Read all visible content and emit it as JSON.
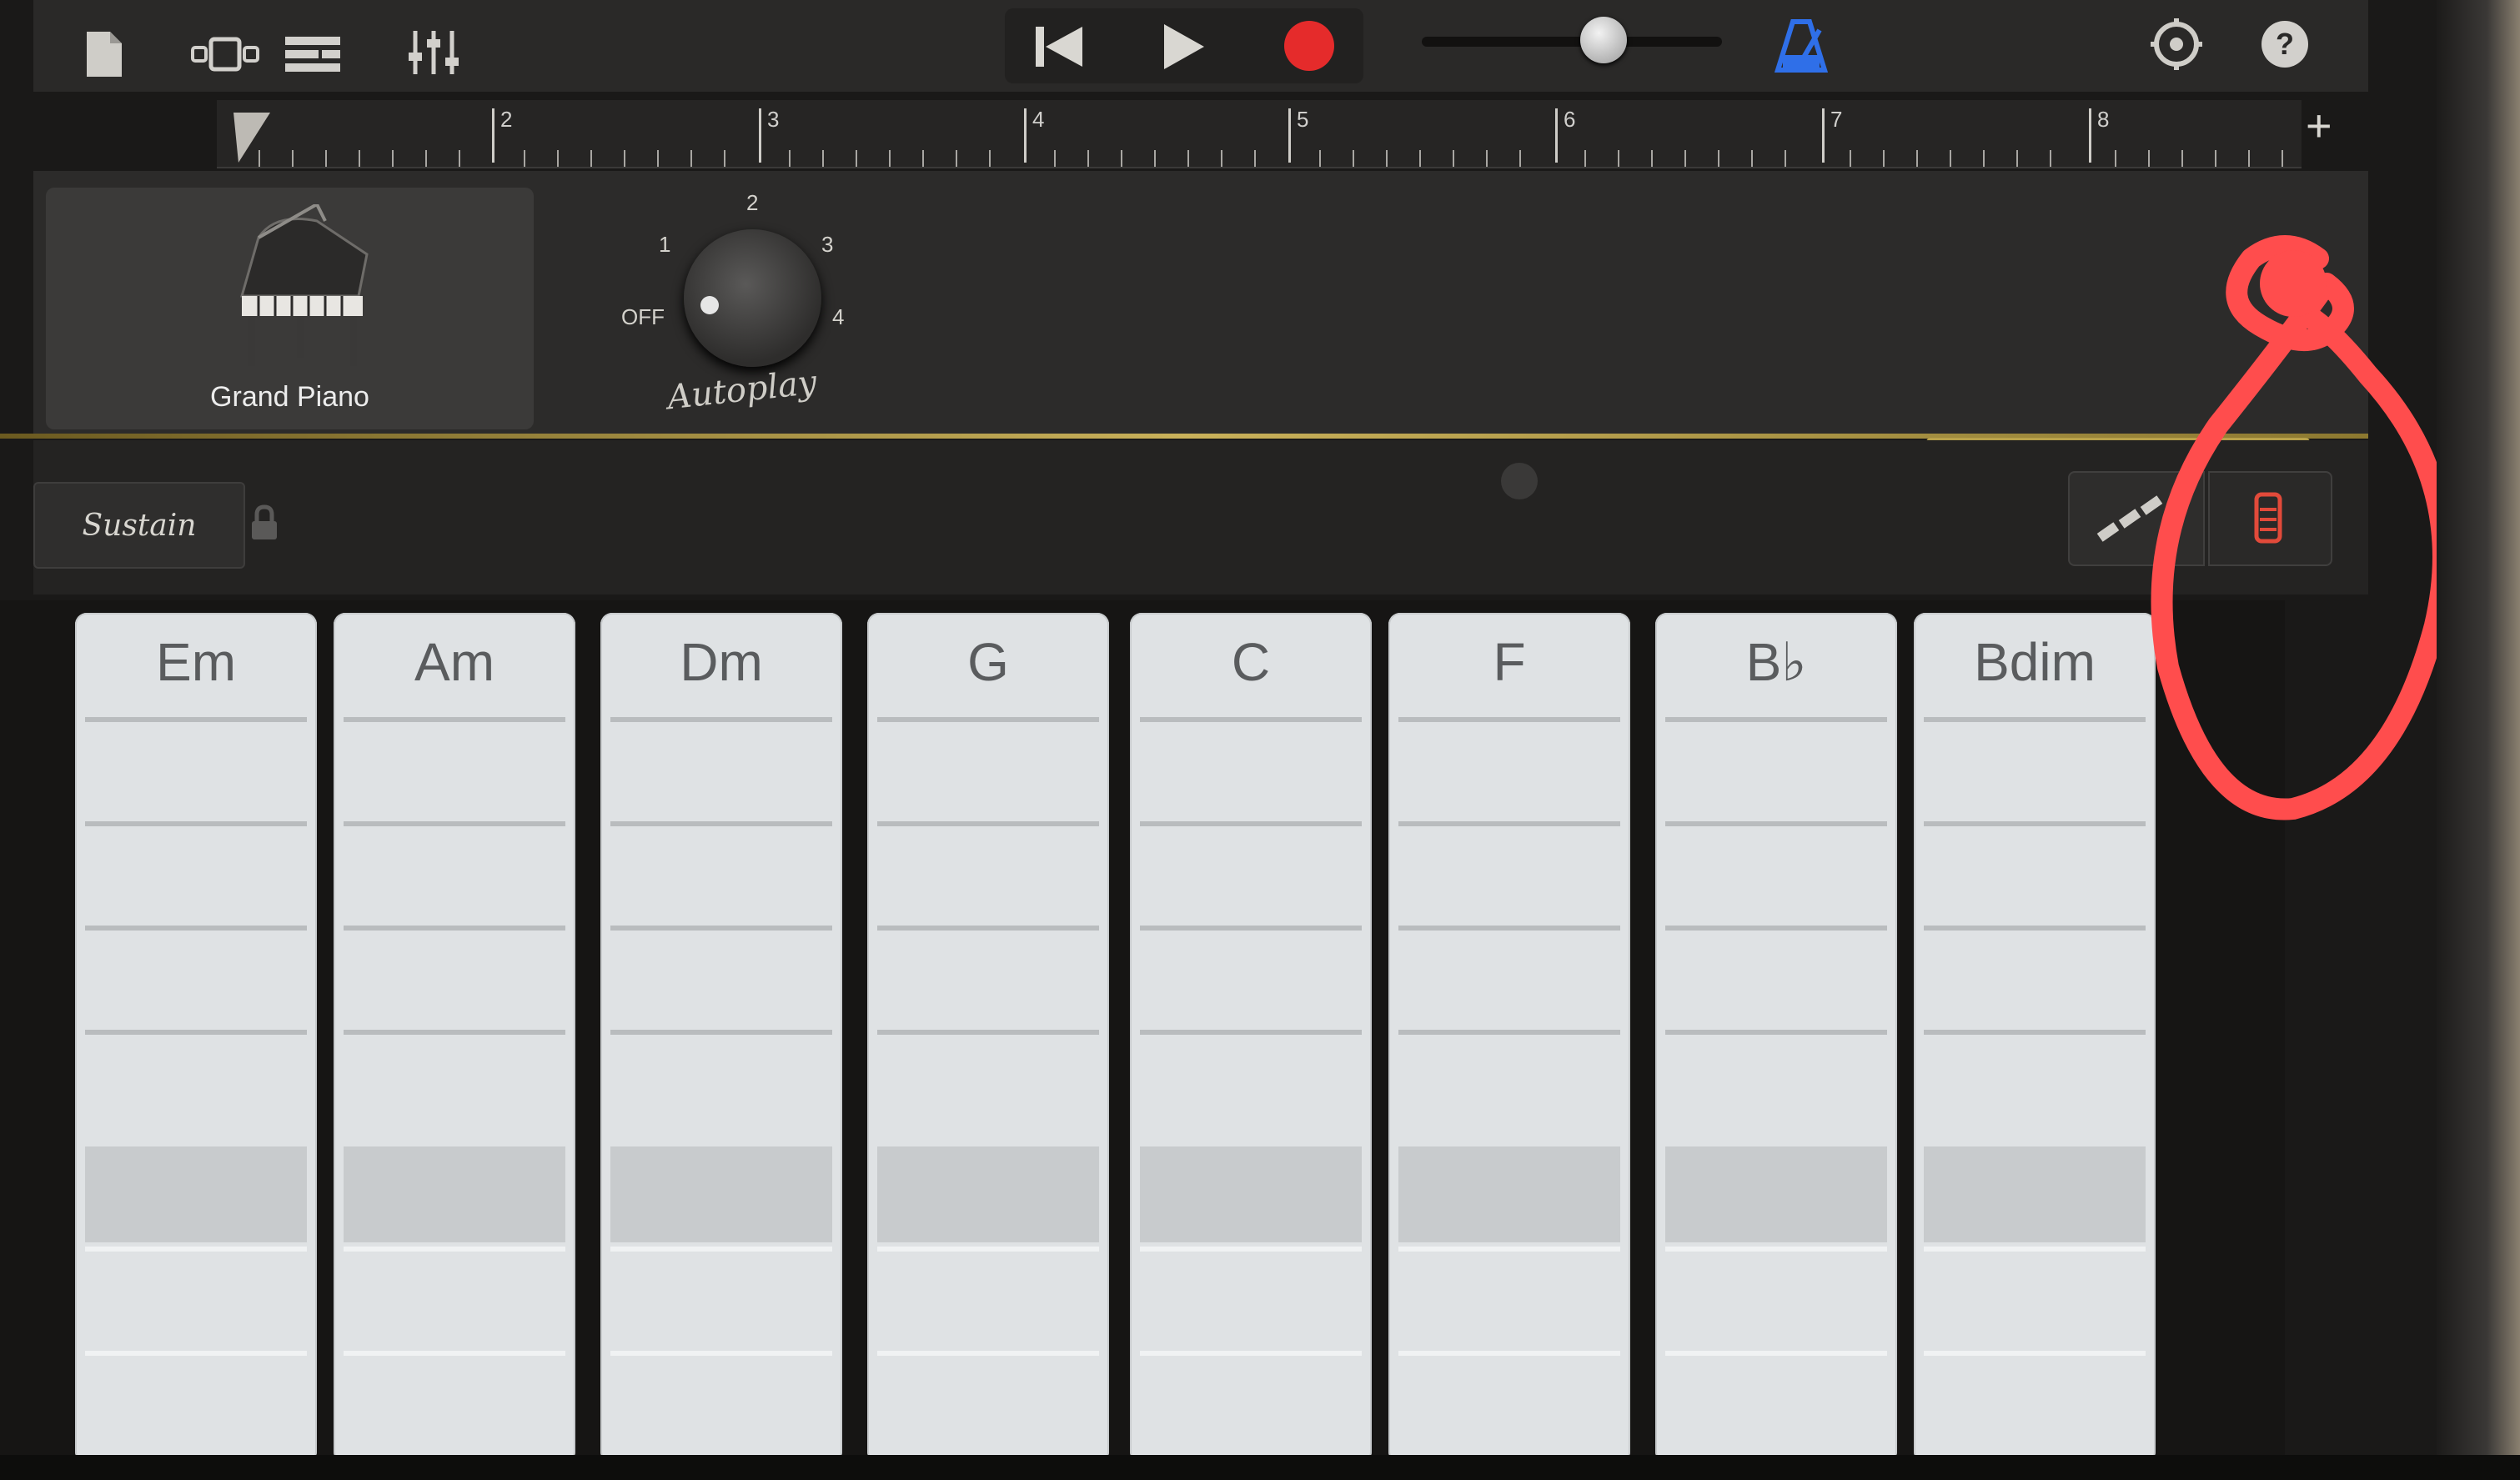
{
  "toolbar": {
    "icons": [
      "document-icon",
      "tracks-view-icon",
      "track-list-icon",
      "mixer-icon",
      "rewind-icon",
      "play-icon",
      "record-icon",
      "volume-slider",
      "metronome-icon",
      "settings-icon",
      "help-icon"
    ],
    "help_label": "?"
  },
  "ruler": {
    "bars": [
      "2",
      "3",
      "4",
      "5",
      "6",
      "7",
      "8"
    ],
    "add_label": "+"
  },
  "instrument": {
    "name": "Grand Piano",
    "icon": "grand-piano-icon"
  },
  "autoplay": {
    "label": "Autoplay",
    "positions": [
      "OFF",
      "1",
      "2",
      "3",
      "4"
    ]
  },
  "sustain": {
    "label": "Sustain"
  },
  "mode_buttons": {
    "arpeggio_icon": "notes-icon",
    "chord_strips_icon": "chord-strip-icon"
  },
  "chords": [
    "Em",
    "Am",
    "Dm",
    "G",
    "C",
    "F",
    "B♭",
    "Bdim"
  ],
  "colors": {
    "record": "#e52b2b",
    "metronome": "#2f6fe8",
    "annotation": "#ff4d4d",
    "chord_strip": "#dfe2e4"
  }
}
